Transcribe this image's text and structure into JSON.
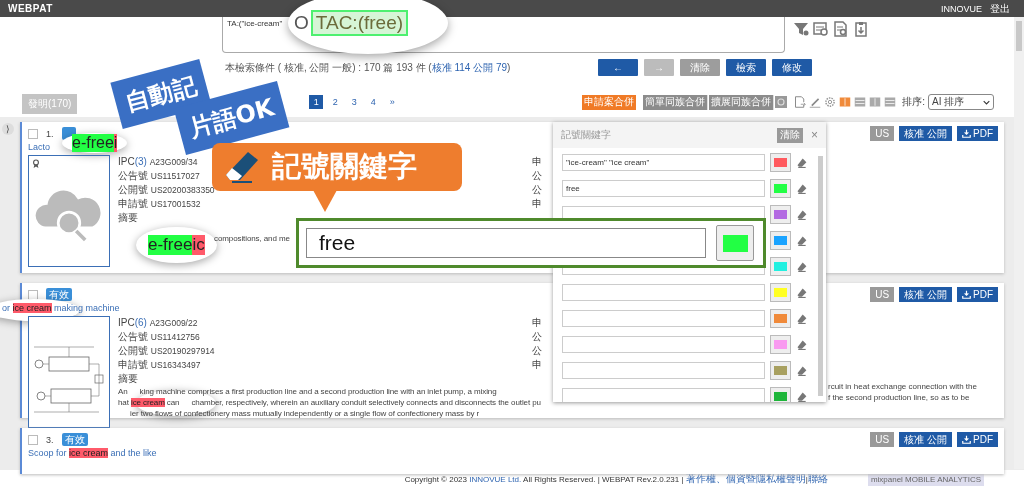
{
  "header": {
    "logo": "WEBPAT",
    "user": "INNOVUE",
    "logout": "登出"
  },
  "query": {
    "value": "TA:(\"ice-cream\""
  },
  "summary": {
    "text": "本檢索條件 ( 核准, 公開 一般) : 170 篇   193 件 (",
    "link": "核准 114 公開 79",
    "suffix": ")"
  },
  "nav_buttons": [
    {
      "label": "←",
      "kind": "primary"
    },
    {
      "label": "→",
      "kind": "disabled"
    },
    {
      "label": "清除",
      "kind": "muted"
    },
    {
      "label": "檢索",
      "kind": "primary"
    },
    {
      "label": "修改",
      "kind": "primary"
    }
  ],
  "result_tabs": [
    {
      "label": "發明(170)"
    }
  ],
  "pagination": [
    {
      "label": "1",
      "selected": true
    },
    {
      "label": "2",
      "selected": false
    },
    {
      "label": "3",
      "selected": false
    },
    {
      "label": "4",
      "selected": false
    },
    {
      "label": "»",
      "selected": false
    }
  ],
  "toolbar": {
    "merge_buttons": [
      {
        "label": "申請案合併",
        "kind": "accent"
      },
      {
        "label": "簡單同族合併",
        "kind": "group"
      },
      {
        "label": "擴展同族合併",
        "kind": "group"
      }
    ],
    "views": [
      {
        "selected": true
      },
      {
        "selected": false
      },
      {
        "selected": false
      },
      {
        "selected": false
      }
    ],
    "sort_label": "排序:",
    "sort_value": "AI 排序"
  },
  "collapse_toggle": "⟩",
  "results": [
    {
      "checked": false,
      "number": "1.",
      "thumbnail": {
        "kind": "placeholder"
      },
      "title": [
        {
          "text": "Lacto"
        }
      ],
      "title_zoom": [
        {
          "text": "e-free",
          "color": "#22ff44"
        },
        {
          "text": "i",
          "color": "#ff5a6a"
        }
      ],
      "fields": [
        {
          "label": "IPC",
          "count": "(3)",
          "value": "A23G009/34"
        },
        {
          "label": "公告號",
          "value": "US11517027"
        },
        {
          "label": "公開號",
          "value": "US20200383350"
        },
        {
          "label": "申請號",
          "value": "US17001532"
        }
      ],
      "side_marks": [
        "申",
        "公",
        "公",
        "申"
      ],
      "abstract_label": "摘要",
      "abstract_zoom": [
        {
          "text": "e-free",
          "color": "#22ff44"
        },
        {
          "text": "ic",
          "color": "#ff5a6a"
        }
      ],
      "abstract_lines": [
        [
          {
            "text": "compositions, and me"
          }
        ]
      ],
      "buttons": [
        "US",
        "核准  公開",
        "PDF"
      ]
    },
    {
      "checked": false,
      "status": "有效",
      "thumbnail": {
        "kind": "picture"
      },
      "title": [
        {
          "text": "or "
        },
        {
          "text": "ice cream",
          "color": "#ff5a6a"
        },
        {
          "text": " making machine"
        }
      ],
      "fields": [
        {
          "label": "IPC",
          "count": "(6)",
          "value": "A23G009/22"
        },
        {
          "label": "公告號",
          "value": "US11412756"
        },
        {
          "label": "公開號",
          "value": "US20190297914"
        },
        {
          "label": "申請號",
          "value": "US16343497"
        }
      ],
      "side_marks": [
        "申",
        "公",
        "公",
        "申"
      ],
      "abstract_label": "摘要",
      "abstract_lines": [
        [
          {
            "text": "An"
          },
          {
            "text": "king machine comprises a first production line and a second production line with an inlet pump, a mixing",
            "gap": true
          }
        ],
        [
          {
            "text": "hat "
          },
          {
            "text": "ice cream",
            "color": "#ff5a6a"
          },
          {
            "text": " can"
          },
          {
            "text": "chamber, respectively, wherein an auxiliary conduit selectively connects and disconnects the outlet pu",
            "gap": true
          }
        ],
        [
          {
            "text": "ier two flows of confectionery mass mutually independently or a single flow of confectionery mass by r",
            "gap": true
          }
        ]
      ],
      "right_lines": [
        "rcuit in heat exchange connection with the",
        "f the second production line, so as to be"
      ],
      "buttons": [
        "US",
        "核准  公開",
        "PDF"
      ]
    },
    {
      "checked": false,
      "number": "3.",
      "status": "有效",
      "title": [
        {
          "text": "Scoop for "
        },
        {
          "text": "ice cream",
          "color": "#ff5a6a"
        },
        {
          "text": " and the like"
        }
      ],
      "buttons": [
        "US",
        "核准  公開",
        "PDF"
      ]
    }
  ],
  "keyword_panel": {
    "title": "記號關鍵字",
    "clear": "清除",
    "close": "×",
    "rows": [
      {
        "value": "\"ice-cream\" \"ice cream\"",
        "color": "#ff5a5f"
      },
      {
        "value": "free",
        "color": "#22ff44"
      },
      {
        "value": "",
        "color": "#b36ae2"
      },
      {
        "value": "",
        "color": "#1aa3ff",
        "covered": true
      },
      {
        "value": "",
        "color": "#22f0e0"
      },
      {
        "value": "",
        "color": "#ffff22"
      },
      {
        "value": "",
        "color": "#f08a3a"
      },
      {
        "value": "",
        "color": "#f99af0"
      },
      {
        "value": "",
        "color": "#a8a060"
      },
      {
        "value": "",
        "color": "#1eb53a"
      }
    ]
  },
  "callouts": {
    "phrase_labels": [
      "自動記",
      "片語OK"
    ],
    "banner": "記號關鍵字",
    "zoom_field": {
      "value": "free",
      "color": "#22ff44"
    },
    "query_zoom": {
      "lead": "O",
      "term": "TAC:(free)"
    }
  },
  "footer": {
    "text": "Copyright © 2023 ",
    "company": "INNOVUE Ltd.",
    "rest": " All Rights Reserved. | WEBPAT Rev.2.0.231 | ",
    "links": [
      "著作權、個資暨隱私權聲明",
      "聯絡"
    ],
    "separator": "|",
    "badge": [
      "mixpanel",
      "MOBILE ANALYTICS"
    ]
  }
}
